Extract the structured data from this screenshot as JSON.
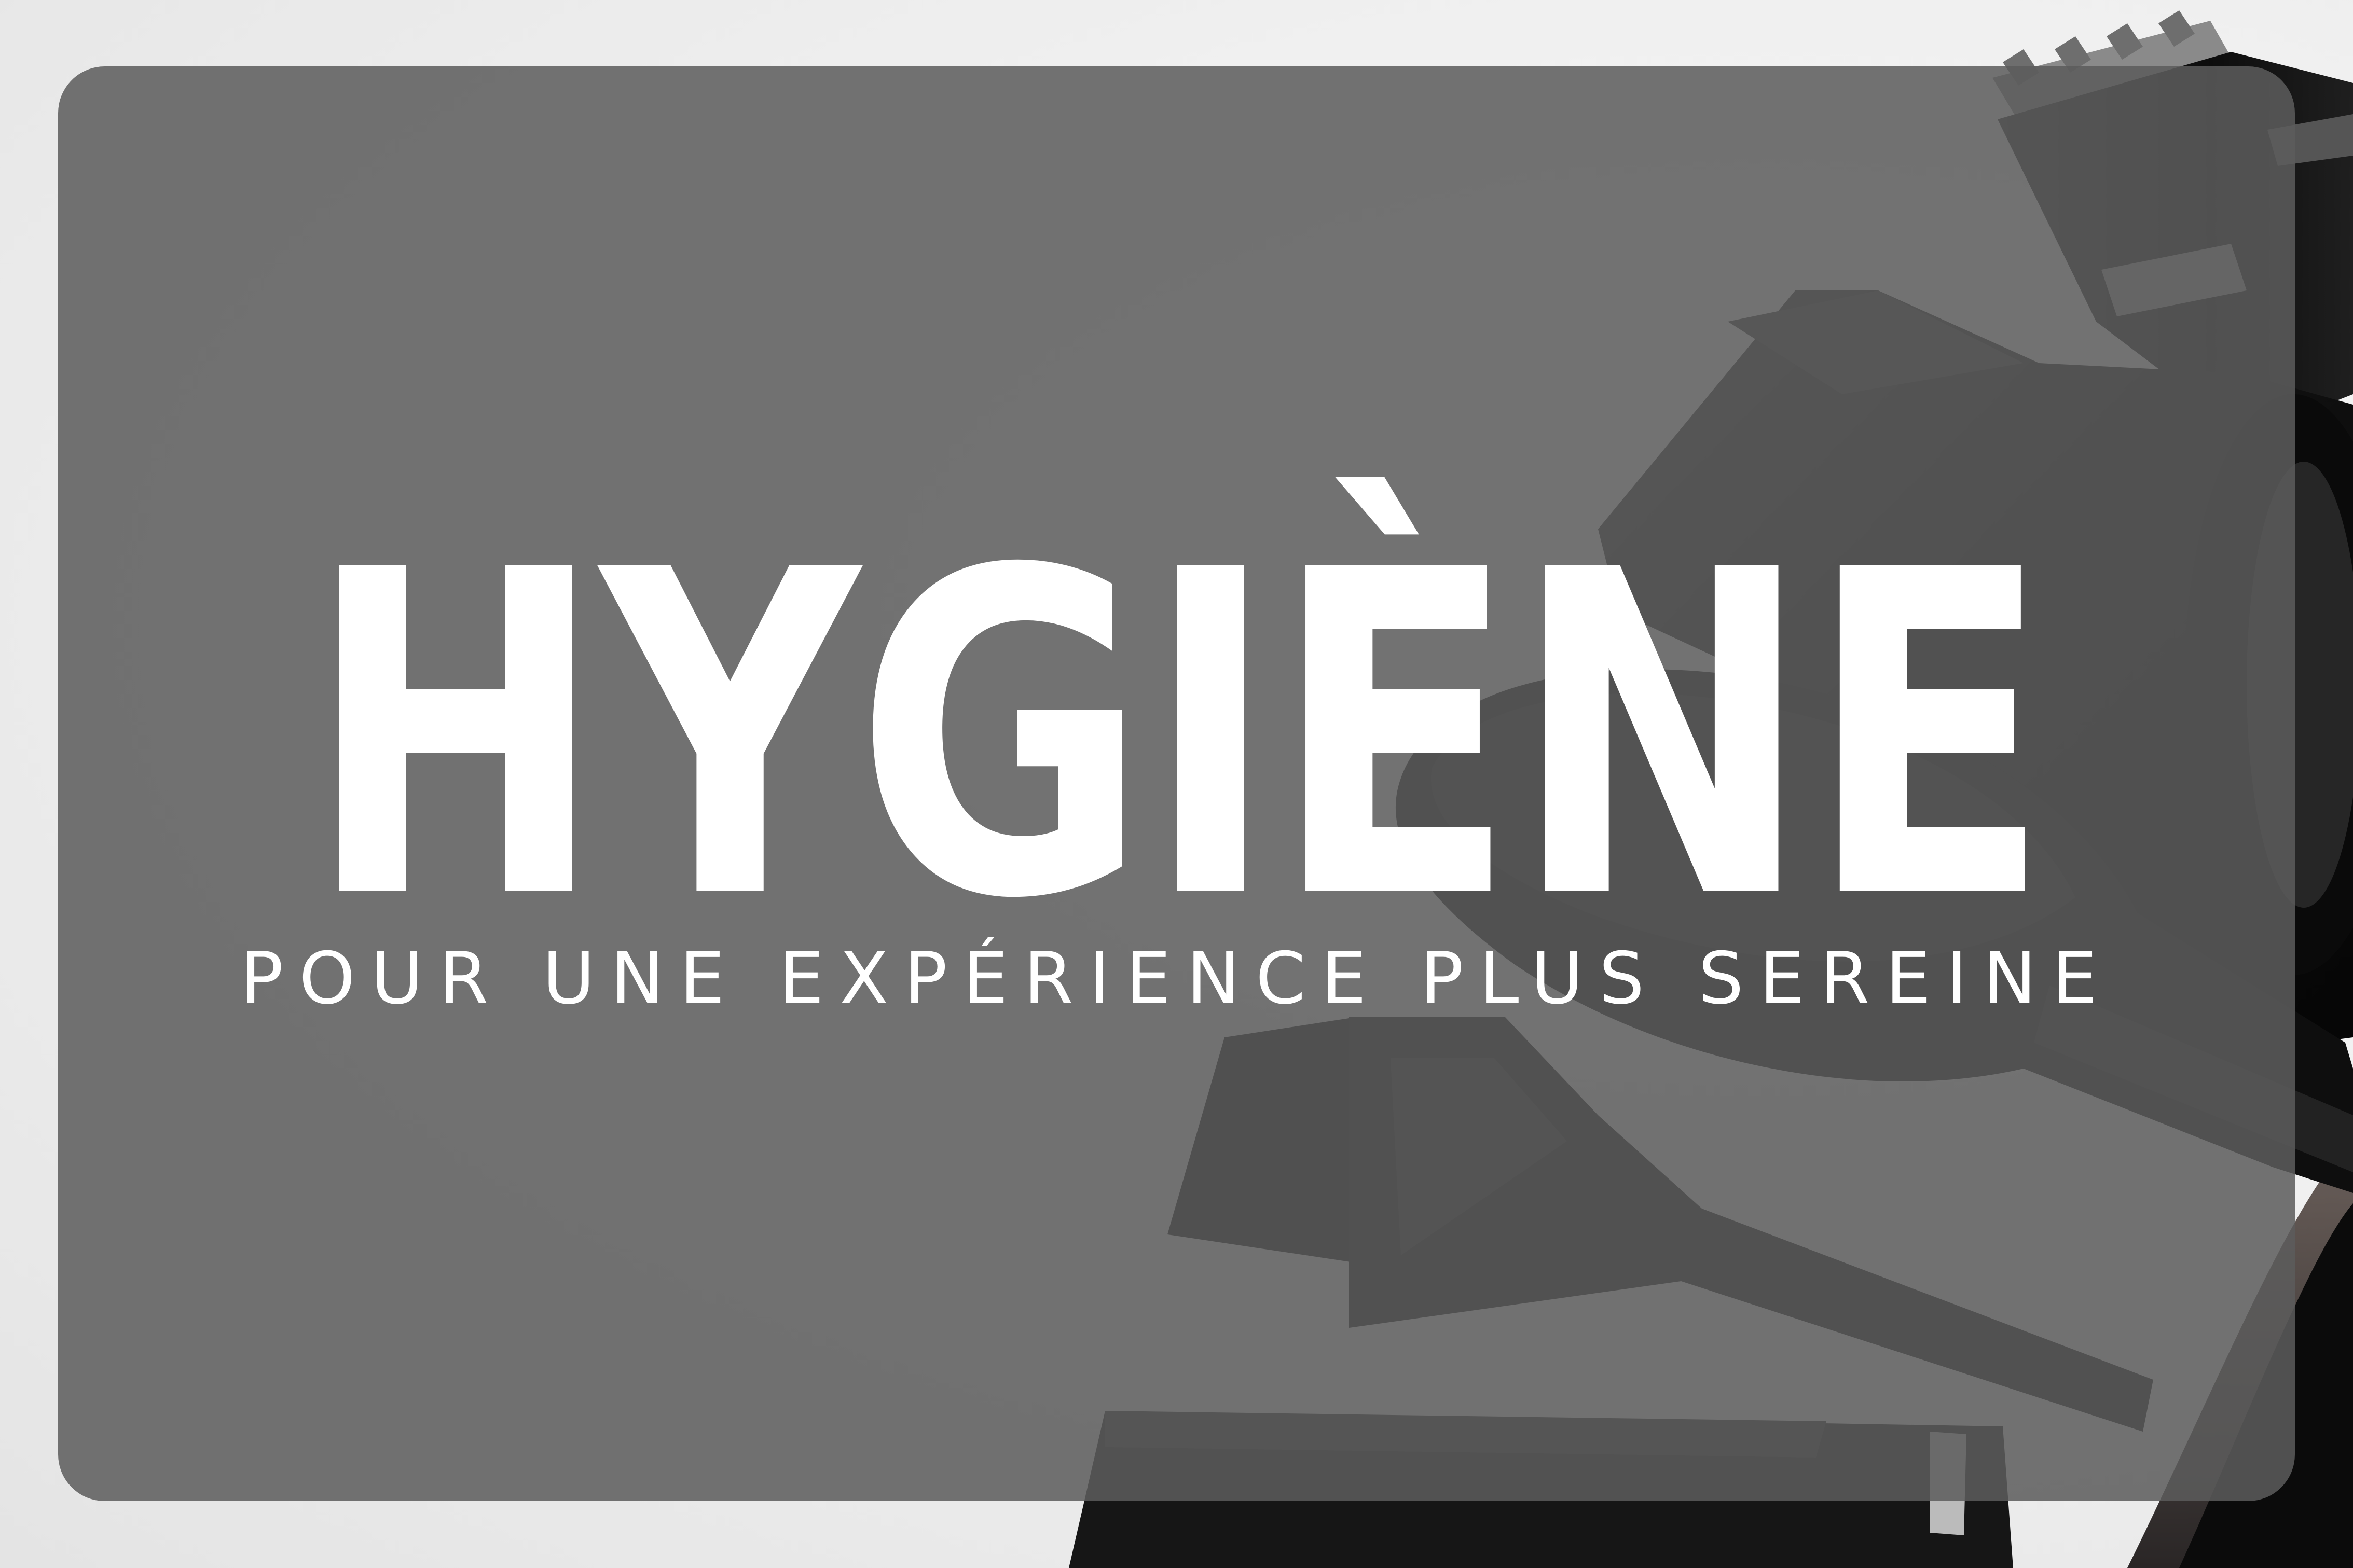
{
  "headline": {
    "title": "HYGIÈNE",
    "subtitle": "POUR UNE EXPÉRIENCE PLUS SEREINE"
  },
  "photo": {
    "subject": [
      "hair-clipper-icon",
      "hair-dryer-icon",
      "bristle-brush-icon",
      "tint-brush-icon",
      "comb-icon"
    ]
  },
  "colors": {
    "overlay": "#5c5c5c",
    "text": "#ffffff",
    "background": "#eeeeee",
    "tools": "#101010"
  }
}
